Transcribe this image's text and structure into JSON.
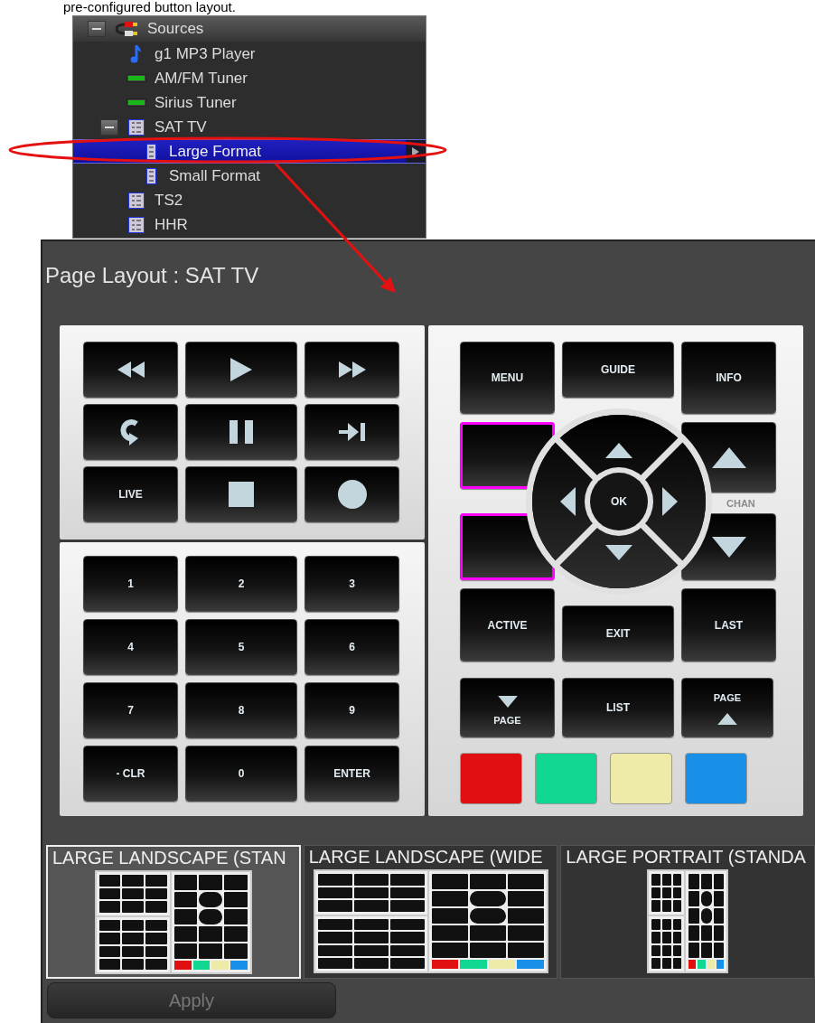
{
  "caption": "pre-configured button layout.",
  "tree": {
    "header": {
      "label": "Sources",
      "expanded": true
    },
    "items": [
      {
        "label": "g1 MP3 Player",
        "kind": "music",
        "selected": false
      },
      {
        "label": "AM/FM Tuner",
        "kind": "tuner",
        "selected": false
      },
      {
        "label": "Sirius Tuner",
        "kind": "tuner",
        "selected": false
      },
      {
        "label": "SAT TV",
        "kind": "device",
        "selected": false,
        "expanded": true,
        "children": [
          {
            "label": "Large Format",
            "kind": "format",
            "selected": true
          },
          {
            "label": "Small Format",
            "kind": "format",
            "selected": false
          }
        ]
      },
      {
        "label": "TS2",
        "kind": "device",
        "selected": false
      },
      {
        "label": "HHR",
        "kind": "device",
        "selected": false
      }
    ]
  },
  "page_layout": {
    "title": "Page Layout : SAT TV",
    "transport": [
      {
        "kind": "rewind"
      },
      {
        "kind": "play"
      },
      {
        "kind": "fast-forward"
      },
      {
        "kind": "replay"
      },
      {
        "kind": "pause"
      },
      {
        "kind": "skip"
      },
      {
        "kind": "text",
        "label": "LIVE"
      },
      {
        "kind": "stop"
      },
      {
        "kind": "record"
      }
    ],
    "keypad": [
      "1",
      "2",
      "3",
      "4",
      "5",
      "6",
      "7",
      "8",
      "9",
      "- CLR",
      "0",
      "ENTER"
    ],
    "top_buttons": [
      "MENU",
      "GUIDE",
      "INFO"
    ],
    "custom_slots": [
      {
        "highlighted": true
      },
      {
        "highlighted": true
      }
    ],
    "dpad": {
      "center": "OK"
    },
    "chan_label": "CHAN",
    "action_buttons": [
      "ACTIVE",
      "EXIT",
      "LAST"
    ],
    "page_down": "PAGE",
    "list": "LIST",
    "page_up": "PAGE",
    "color_buttons": [
      {
        "color": "#e01010"
      },
      {
        "color": "#10d890"
      },
      {
        "color": "#eeeaa8"
      },
      {
        "color": "#1890e8"
      }
    ],
    "layouts": [
      {
        "label": "LARGE LANDSCAPE (STAN",
        "kind": "landscape",
        "selected": true
      },
      {
        "label": "LARGE LANDSCAPE (WIDE",
        "kind": "wide",
        "selected": false
      },
      {
        "label": "LARGE PORTRAIT (STANDA",
        "kind": "portrait",
        "selected": false
      }
    ],
    "apply": {
      "label": "Apply",
      "disabled": true
    }
  }
}
